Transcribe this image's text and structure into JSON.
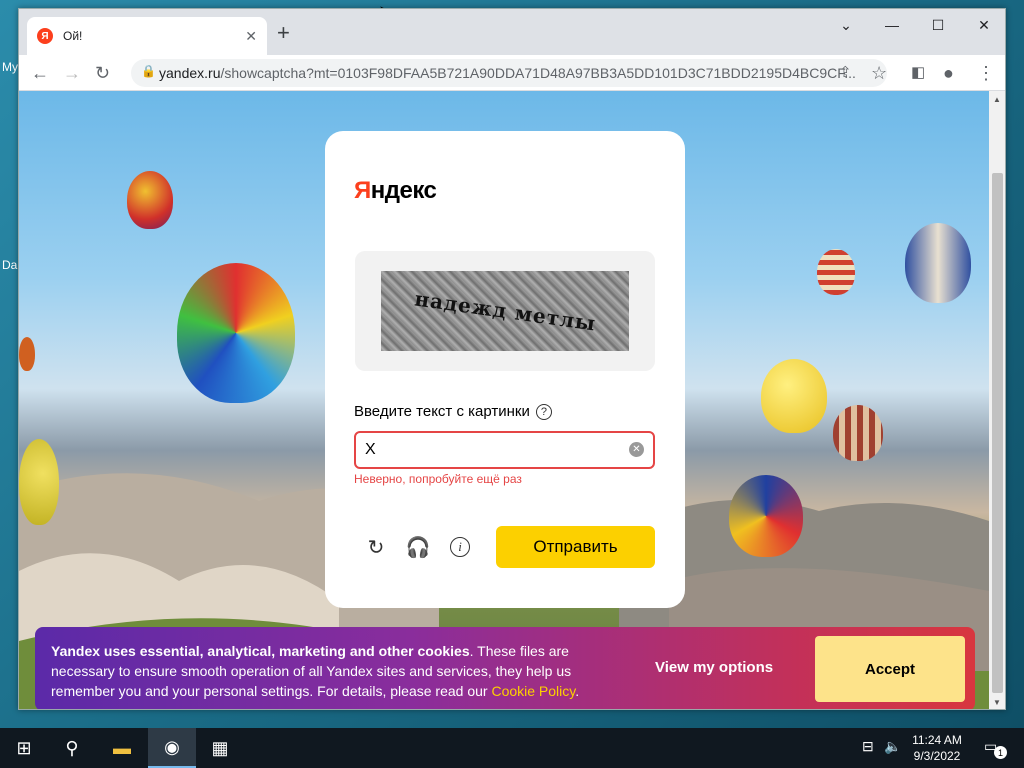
{
  "desktop": {
    "label_my": "My",
    "label_da": "Da"
  },
  "browser": {
    "tab": {
      "favicon": "Я",
      "title": "Ой!",
      "close": "✕"
    },
    "new_tab": "+",
    "controls": {
      "dropdown": "⌄",
      "minimize": "—",
      "maximize": "☐",
      "close": "✕"
    },
    "url_domain": "yandex.ru",
    "url_rest": "/showcaptcha?mt=0103F98DFAA5B721A90DDA71D48A97BB3A5DD101D3C71BDD2195D4BC9CF..."
  },
  "captcha": {
    "logo_ya": "Я",
    "logo_rest": "ндекс",
    "captcha_text": "надежд метлы",
    "prompt": "Введите текст с картинки",
    "help": "?",
    "input_value": "X",
    "error": "Неверно, попробуйте ещё раз",
    "submit": "Отправить"
  },
  "cookie": {
    "bold": "Yandex uses essential, analytical, marketing and other cookies",
    "text": ". These files are necessary to ensure smooth operation of all Yandex sites and services, they help us remember you and your personal settings. For details, please read our ",
    "link": "Cookie Policy",
    "end": ".",
    "view_options": "View my options",
    "accept": "Accept"
  },
  "taskbar": {
    "time": "11:24 AM",
    "date": "9/3/2022",
    "notifications": "1"
  },
  "colors": {
    "yandex_red": "#fc3f1d",
    "yandex_yellow": "#fcd000",
    "error_red": "#e54545"
  }
}
